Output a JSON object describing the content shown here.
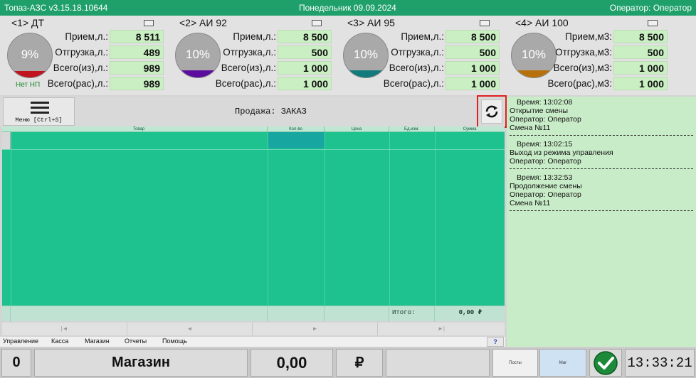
{
  "titlebar": {
    "app": "Топаз-АЗС  v3.15.18.10644",
    "date": "Понедельник 09.09.2024",
    "operator": "Оператор: Оператор"
  },
  "tanks": [
    {
      "name": "<1> ДТ",
      "percent": "9%",
      "level": 0.09,
      "color": "#c1121f",
      "note": "Нет НП",
      "rows": [
        {
          "label": "Прием,л.:",
          "value": "8 511"
        },
        {
          "label": "Отгрузка,л.:",
          "value": "489"
        },
        {
          "label": "Всего(из),л.:",
          "value": "989"
        },
        {
          "label": "Всего(рас),л.:",
          "value": "989"
        }
      ]
    },
    {
      "name": "<2> АИ 92",
      "percent": "10%",
      "level": 0.1,
      "color": "#5a0d9e",
      "note": "",
      "rows": [
        {
          "label": "Прием,л.:",
          "value": "8 500"
        },
        {
          "label": "Отгрузка,л.:",
          "value": "500"
        },
        {
          "label": "Всего(из),л.:",
          "value": "1 000"
        },
        {
          "label": "Всего(рас),л.:",
          "value": "1 000"
        }
      ]
    },
    {
      "name": "<3> АИ 95",
      "percent": "10%",
      "level": 0.1,
      "color": "#127a7a",
      "note": "",
      "rows": [
        {
          "label": "Прием,л.:",
          "value": "8 500"
        },
        {
          "label": "Отгрузка,л.:",
          "value": "500"
        },
        {
          "label": "Всего(из),л.:",
          "value": "1 000"
        },
        {
          "label": "Всего(рас),л.:",
          "value": "1 000"
        }
      ]
    },
    {
      "name": "<4> АИ 100",
      "percent": "10%",
      "level": 0.1,
      "color": "#b8700a",
      "note": "",
      "rows": [
        {
          "label": "Прием,м3:",
          "value": "8 500"
        },
        {
          "label": "Отгрузка,м3:",
          "value": "500"
        },
        {
          "label": "Всего(из),м3:",
          "value": "1 000"
        },
        {
          "label": "Всего(рас),м3:",
          "value": "1 000"
        }
      ]
    }
  ],
  "toolbar": {
    "menu_label": "Меню [Ctrl+S]",
    "menu_icon": "hamburger-icon",
    "sale_title": "Продажа: ЗАКАЗ",
    "refresh_icon": "refresh-icon"
  },
  "grid": {
    "columns": [
      "Товар",
      "Кол-во",
      "Цена",
      "Ед.изм.",
      "Сумма"
    ],
    "total_label": "Итого:",
    "total_value": "0,00 ₽"
  },
  "nav": [
    "|◄",
    "◄",
    "►",
    "►|"
  ],
  "menu": [
    "Управление",
    "Касса",
    "Магазин",
    "Отчеты",
    "Помощь"
  ],
  "help_label": "?",
  "log": [
    {
      "time": "Время: 13:02:08",
      "lines": [
        "Открытие смены",
        "Оператор: Оператор",
        "Смена №11"
      ]
    },
    {
      "time": "Время: 13:02:15",
      "lines": [
        "Выход из режима управления",
        "Оператор: Оператор"
      ]
    },
    {
      "time": "Время: 13:32:53",
      "lines": [
        "Продолжение смены",
        "Оператор: Оператор",
        "Смена №11"
      ]
    }
  ],
  "status": {
    "count": "0",
    "mode": "Магазин",
    "amount": "0,00",
    "currency": "₽",
    "seg_posts": "Посты",
    "seg_shop": "Маг",
    "ok_icon": "checkmark-icon",
    "clock": "13:33:21"
  },
  "colors": {
    "accent": "#1fa06a",
    "grid": "#1ec28e",
    "log_bg": "#c9ecc8",
    "value_bg": "#c9efc2",
    "highlight": "#e02020"
  }
}
